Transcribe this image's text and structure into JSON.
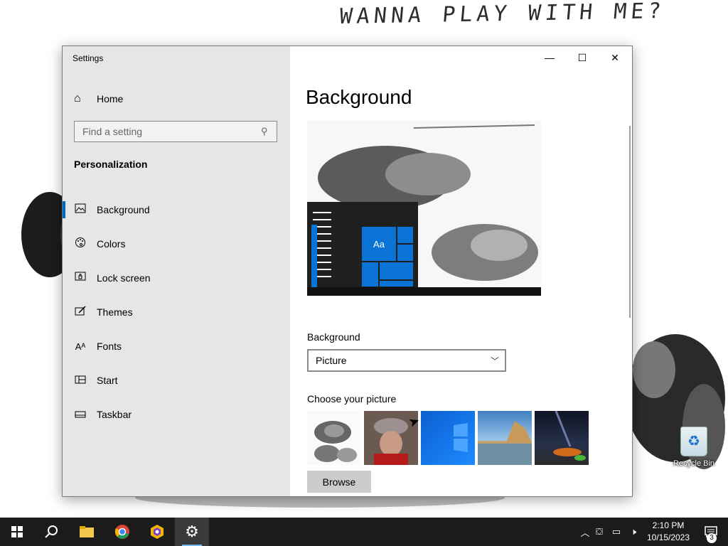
{
  "desktop": {
    "wallpaper_caption": "WANNA PLAY WITH ME?",
    "recycle_bin_label": "Recycle Bin"
  },
  "window": {
    "title": "Settings",
    "minimize_icon": "minimize-icon",
    "maximize_icon": "maximize-icon",
    "close_icon": "close-icon"
  },
  "sidebar": {
    "home_label": "Home",
    "search_placeholder": "Find a setting",
    "section_title": "Personalization",
    "items": [
      {
        "label": "Background",
        "icon": "picture-icon",
        "active": true
      },
      {
        "label": "Colors",
        "icon": "palette-icon",
        "active": false
      },
      {
        "label": "Lock screen",
        "icon": "lock-screen-icon",
        "active": false
      },
      {
        "label": "Themes",
        "icon": "themes-icon",
        "active": false
      },
      {
        "label": "Fonts",
        "icon": "fonts-icon",
        "active": false
      },
      {
        "label": "Start",
        "icon": "start-icon",
        "active": false
      },
      {
        "label": "Taskbar",
        "icon": "taskbar-icon",
        "active": false
      }
    ]
  },
  "main": {
    "page_title": "Background",
    "preview_tile_text": "Aa",
    "background_label": "Background",
    "background_value": "Picture",
    "choose_label": "Choose your picture",
    "browse_label": "Browse"
  },
  "taskbar": {
    "time": "2:10 PM",
    "date": "10/15/2023",
    "notification_count": "3"
  },
  "colors": {
    "accent": "#0067c0",
    "sidebar_bg": "#e6e6e6",
    "taskbar_bg": "#1b1b1b"
  }
}
